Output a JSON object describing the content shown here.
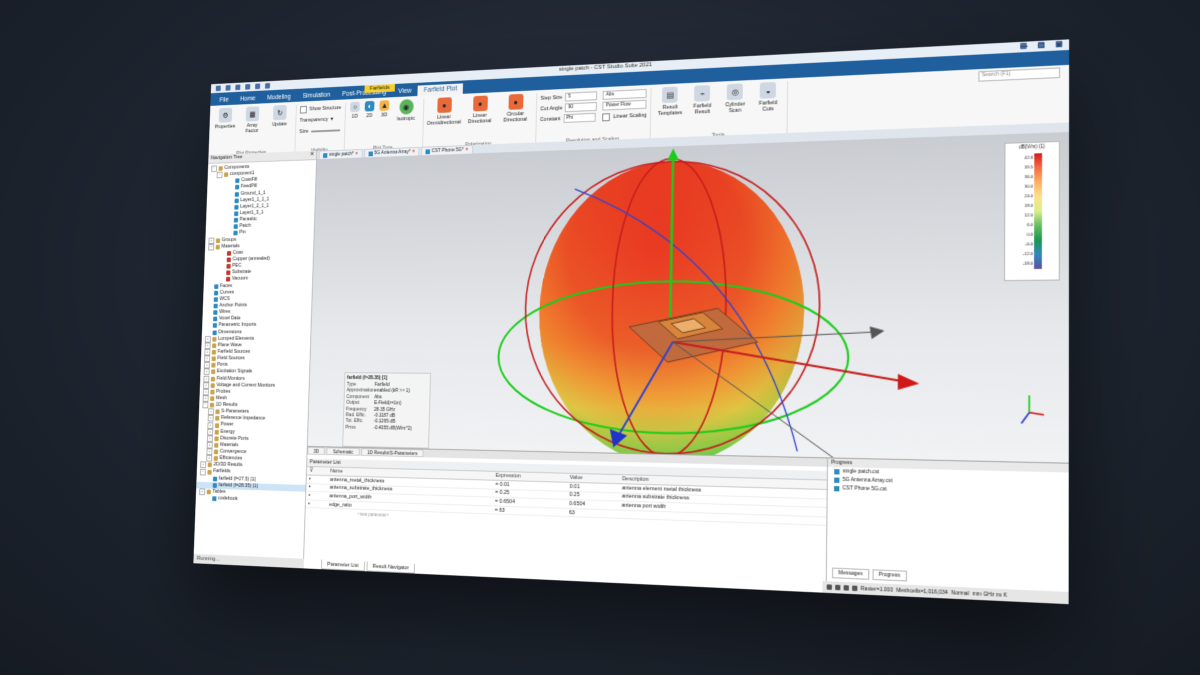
{
  "window": {
    "title": "single patch - CST Studio Suite 2021"
  },
  "menu": {
    "file": "File",
    "home": "Home",
    "modeling": "Modeling",
    "simulation": "Simulation",
    "post_processing": "Post-Processing",
    "view": "View",
    "farfield_plot": "Farfield Plot",
    "context_label": "Farfields"
  },
  "ribbon": {
    "properties": "Properties",
    "array_factor": "Array Factor",
    "update": "Update",
    "plot_properties_group": "Plot Properties",
    "show_structure": "Show Structure",
    "transparency": "Transparency",
    "size": "Size",
    "visibility_group": "Visibility",
    "plot_1d": "1D",
    "plot_2d": "2D",
    "plot_3d": "3D",
    "plot_type_group": "Plot Type",
    "isotropic": "Isotropic",
    "linear_omni": "Linear Omnidirectional",
    "linear_dir": "Linear Directional",
    "circular_dir": "Circular Directional",
    "polarization_group": "Polarization",
    "step_size": "Step Size",
    "step_size_val": "5",
    "cut_angle": "Cut Angle",
    "cut_angle_val": "90",
    "constant": "Constant",
    "constant_val": "Phi",
    "abs_val": "Abs",
    "power_flow": "Power Flow",
    "linear_scaling": "Linear Scaling",
    "resolution_group": "Resolution and Scaling",
    "result_templates": "Result Templates",
    "farfield_result": "Farfield Result",
    "cylinder_scan": "Cylinder Scan",
    "farfield_cuts": "Farfield Cuts",
    "tools_group": "Tools",
    "search_placeholder": "Search (F1)"
  },
  "doc_tabs": [
    "single patch*",
    "5G Antenna Array*",
    "CST Phone 5G*"
  ],
  "nav": {
    "header": "Navigation Tree",
    "items": [
      {
        "label": "Components",
        "level": 0,
        "toggle": "−",
        "icon": "fold"
      },
      {
        "label": "component1",
        "level": 1,
        "toggle": "−",
        "icon": "fold"
      },
      {
        "label": "CoaxFill",
        "level": 3,
        "toggle": "",
        "icon": "blue"
      },
      {
        "label": "FeedPill",
        "level": 3,
        "toggle": "",
        "icon": "blue"
      },
      {
        "label": "Ground_1_1",
        "level": 3,
        "toggle": "",
        "icon": "blue"
      },
      {
        "label": "Layer1_1_1_1",
        "level": 3,
        "toggle": "",
        "icon": "blue"
      },
      {
        "label": "Layer1_2_1_1",
        "level": 3,
        "toggle": "",
        "icon": "blue"
      },
      {
        "label": "Layer1_3_1",
        "level": 3,
        "toggle": "",
        "icon": "blue"
      },
      {
        "label": "Parasitic",
        "level": 3,
        "toggle": "",
        "icon": "blue"
      },
      {
        "label": "Patch",
        "level": 3,
        "toggle": "",
        "icon": "blue"
      },
      {
        "label": "Pin",
        "level": 3,
        "toggle": "",
        "icon": "blue"
      },
      {
        "label": "Groups",
        "level": 0,
        "toggle": "+",
        "icon": "fold"
      },
      {
        "label": "Materials",
        "level": 0,
        "toggle": "−",
        "icon": "fold"
      },
      {
        "label": "Coax",
        "level": 2,
        "toggle": "",
        "icon": "red"
      },
      {
        "label": "Copper (annealed)",
        "level": 2,
        "toggle": "",
        "icon": "red"
      },
      {
        "label": "PEC",
        "level": 2,
        "toggle": "",
        "icon": "red"
      },
      {
        "label": "Substrate",
        "level": 2,
        "toggle": "",
        "icon": "red"
      },
      {
        "label": "Vacuum",
        "level": 2,
        "toggle": "",
        "icon": "red"
      },
      {
        "label": "Faces",
        "level": 0,
        "toggle": "",
        "icon": "blue"
      },
      {
        "label": "Curves",
        "level": 0,
        "toggle": "",
        "icon": "blue"
      },
      {
        "label": "WCS",
        "level": 0,
        "toggle": "",
        "icon": "blue"
      },
      {
        "label": "Anchor Points",
        "level": 0,
        "toggle": "",
        "icon": "blue"
      },
      {
        "label": "Wires",
        "level": 0,
        "toggle": "",
        "icon": "blue"
      },
      {
        "label": "Voxel Data",
        "level": 0,
        "toggle": "",
        "icon": "blue"
      },
      {
        "label": "Parametric Imports",
        "level": 0,
        "toggle": "",
        "icon": "blue"
      },
      {
        "label": "Dimensions",
        "level": 0,
        "toggle": "",
        "icon": "blue"
      },
      {
        "label": "Lumped Elements",
        "level": 0,
        "toggle": "+",
        "icon": "fold"
      },
      {
        "label": "Plane Wave",
        "level": 0,
        "toggle": "+",
        "icon": "fold"
      },
      {
        "label": "Farfield Sources",
        "level": 0,
        "toggle": "+",
        "icon": "fold"
      },
      {
        "label": "Field Sources",
        "level": 0,
        "toggle": "+",
        "icon": "fold"
      },
      {
        "label": "Ports",
        "level": 0,
        "toggle": "+",
        "icon": "fold"
      },
      {
        "label": "Excitation Signals",
        "level": 0,
        "toggle": "+",
        "icon": "fold"
      },
      {
        "label": "Field Monitors",
        "level": 0,
        "toggle": "+",
        "icon": "fold"
      },
      {
        "label": "Voltage and Current Monitors",
        "level": 0,
        "toggle": "+",
        "icon": "fold"
      },
      {
        "label": "Probes",
        "level": 0,
        "toggle": "+",
        "icon": "fold"
      },
      {
        "label": "Mesh",
        "level": 0,
        "toggle": "+",
        "icon": "fold"
      },
      {
        "label": "1D Results",
        "level": 0,
        "toggle": "−",
        "icon": "fold"
      },
      {
        "label": "S-Parameters",
        "level": 1,
        "toggle": "+",
        "icon": "fold"
      },
      {
        "label": "Reference Impedance",
        "level": 1,
        "toggle": "+",
        "icon": "fold"
      },
      {
        "label": "Power",
        "level": 1,
        "toggle": "+",
        "icon": "fold"
      },
      {
        "label": "Energy",
        "level": 1,
        "toggle": "+",
        "icon": "fold"
      },
      {
        "label": "Discrete Ports",
        "level": 1,
        "toggle": "+",
        "icon": "fold"
      },
      {
        "label": "Materials",
        "level": 1,
        "toggle": "+",
        "icon": "fold"
      },
      {
        "label": "Convergence",
        "level": 1,
        "toggle": "+",
        "icon": "fold"
      },
      {
        "label": "Efficiencies",
        "level": 1,
        "toggle": "+",
        "icon": "fold"
      },
      {
        "label": "2D/3D Results",
        "level": 0,
        "toggle": "+",
        "icon": "fold"
      },
      {
        "label": "Farfields",
        "level": 0,
        "toggle": "−",
        "icon": "fold"
      },
      {
        "label": "farfield (f=27.5) [1]",
        "level": 1,
        "toggle": "",
        "icon": "blue"
      },
      {
        "label": "farfield (f=28.35) [1]",
        "level": 1,
        "toggle": "",
        "icon": "blue",
        "selected": true
      },
      {
        "label": "Tables",
        "level": 0,
        "toggle": "+",
        "icon": "fold"
      },
      {
        "label": "codebook",
        "level": 1,
        "toggle": "",
        "icon": "blue"
      }
    ]
  },
  "status": {
    "text": "Running..."
  },
  "farfield_info": {
    "title": "farfield (f=28.35) [1]",
    "rows": [
      {
        "k": "Type",
        "v": "Farfield"
      },
      {
        "k": "Approximation",
        "v": "enabled (kR >> 1)"
      },
      {
        "k": "Component",
        "v": "Abs"
      },
      {
        "k": "Output",
        "v": "E-Field(r=1m)"
      },
      {
        "k": "Frequency",
        "v": "28.35 GHz"
      },
      {
        "k": "Rad. Effic.",
        "v": "-0.1187 dB"
      },
      {
        "k": "Tot. Effic.",
        "v": "-0.1265 dB"
      },
      {
        "k": "Prms",
        "v": "-0.4055 dB(W/m^2)"
      }
    ]
  },
  "legend": {
    "title": "dB(V/m) (1)",
    "ticks": [
      "42.6",
      "39.5",
      "36.0",
      "30.0",
      "24.0",
      "18.0",
      "12.0",
      "6.0",
      "0.0",
      "-6.0",
      "-12.0",
      "-18.0"
    ]
  },
  "lower_tabs": [
    "3D",
    "Schematic",
    "1D Results\\S-Parameters"
  ],
  "param_list": {
    "header": "Parameter List",
    "col_name": "Name",
    "col_expr": "Expression",
    "col_value": "Value",
    "col_desc": "Description",
    "rows": [
      {
        "name": "antenna_metal_thickness",
        "expr": "= 0.01",
        "value": "0.01",
        "desc": "antenna element metal thickness"
      },
      {
        "name": "antenna_substrate_thickness",
        "expr": "= 0.25",
        "value": "0.25",
        "desc": "antenna substrate thickness"
      },
      {
        "name": "antenna_port_width",
        "expr": "= 0.6504",
        "value": "0.6504",
        "desc": "antenna port width"
      },
      {
        "name": "edge_ratio",
        "expr": "= 63",
        "value": "63",
        "desc": ""
      }
    ],
    "new_param": "<new parameter>"
  },
  "bottom_tabs": [
    "Parameter List",
    "Result Navigator"
  ],
  "projects": {
    "header": "Progress",
    "items": [
      "single patch.cst",
      "5G Antenna Array.cst",
      "CST Phone 5G.cst"
    ]
  },
  "prog_tabs": [
    "Messages",
    "Progress"
  ],
  "statusbar": {
    "raster": "Raster=1.000",
    "mesh": "Meshcells=1,016,034",
    "mode": "Normal",
    "units": "mm  GHz  ns  K"
  }
}
